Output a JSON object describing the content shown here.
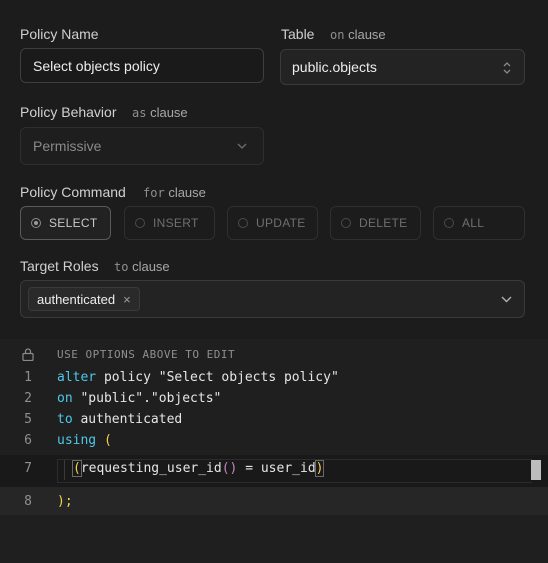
{
  "policy_name": {
    "label": "Policy Name",
    "value": "Select objects policy"
  },
  "table": {
    "label": "Table",
    "clause_kw": "on",
    "clause_word": "clause",
    "value": "public.objects"
  },
  "behavior": {
    "label": "Policy Behavior",
    "clause_kw": "as",
    "clause_word": "clause",
    "value": "Permissive"
  },
  "command": {
    "label": "Policy Command",
    "clause_kw": "for",
    "clause_word": "clause",
    "options": [
      "SELECT",
      "INSERT",
      "UPDATE",
      "DELETE",
      "ALL"
    ],
    "selected": "SELECT"
  },
  "roles": {
    "label": "Target Roles",
    "clause_kw": "to",
    "clause_word": "clause",
    "chips": [
      "authenticated"
    ]
  },
  "editor": {
    "hint": "USE OPTIONS ABOVE TO EDIT",
    "line_numbers": [
      "1",
      "2",
      "5",
      "6",
      "7",
      "8"
    ],
    "line1_kw": "alter",
    "line1_rest": " policy \"Select objects policy\"",
    "line2_kw": "on",
    "line2_rest": " \"public\".\"objects\"",
    "line5_kw": "to",
    "line5_rest": " authenticated",
    "line6_kw": "using",
    "line6_paren": "(",
    "line7_open": "(",
    "line7_fn": "requesting_user_id",
    "line7_call": "()",
    "line7_rest": " = user_id",
    "line7_close": ")",
    "line8": ");"
  }
}
